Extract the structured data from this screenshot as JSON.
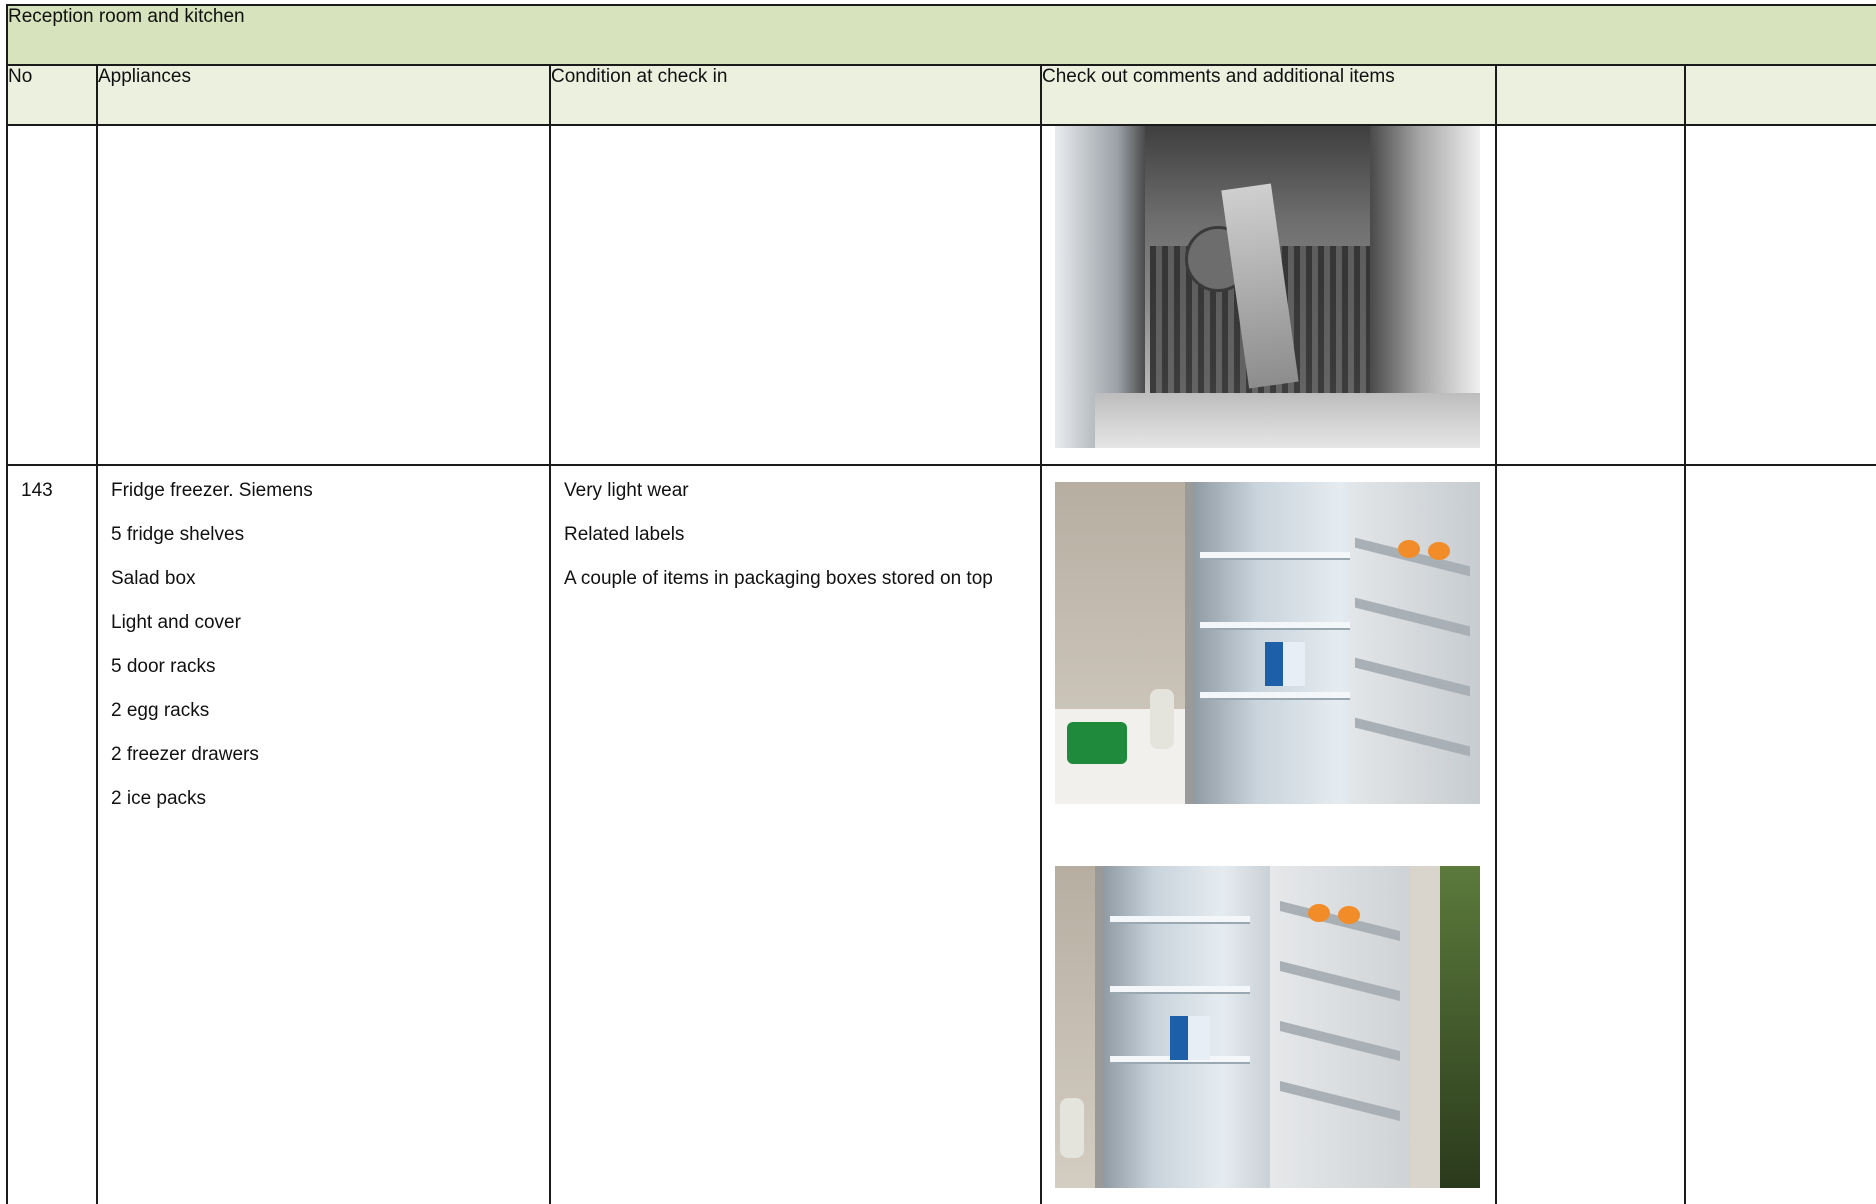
{
  "section": {
    "title": "Reception room and kitchen"
  },
  "headers": {
    "no": "No",
    "appliances": "Appliances",
    "condition": "Condition at check in",
    "checkout": "Check out comments and additional items",
    "extra1": "",
    "extra2": ""
  },
  "rows": [
    {
      "no": "",
      "appliances": [],
      "condition": [],
      "photos": [
        "dishwasher-interior"
      ]
    },
    {
      "no": "143",
      "appliances": [
        "Fridge freezer. Siemens",
        "5 fridge shelves",
        "Salad box",
        "Light and cover",
        "5 door racks",
        "2 egg racks",
        "2 freezer drawers",
        "2 ice packs"
      ],
      "condition": [
        "Very light wear",
        "Related labels",
        "A couple of items in packaging boxes stored on top"
      ],
      "photos": [
        "fridge-open-front",
        "fridge-open-angle"
      ]
    }
  ]
}
